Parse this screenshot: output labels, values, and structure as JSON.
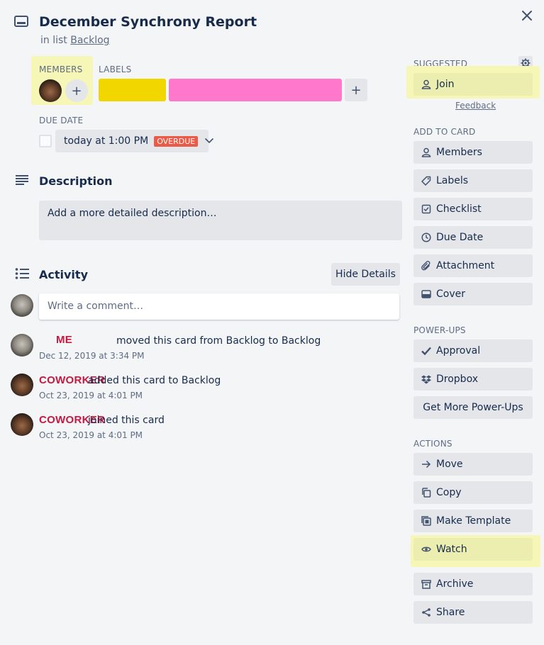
{
  "card": {
    "title": "December Synchrony Report",
    "in_list_prefix": "in list",
    "list_name": "Backlog"
  },
  "members": {
    "label": "MEMBERS",
    "add_label": "+"
  },
  "labels": {
    "label": "LABELS",
    "colors": [
      "#f2d600",
      "#ff78cb"
    ],
    "add_label": "+"
  },
  "due_date": {
    "label": "DUE DATE",
    "value": "today at 1:00 PM",
    "badge": "OVERDUE",
    "badge_color": "#eb5a46",
    "completed": false
  },
  "description": {
    "heading": "Description",
    "placeholder": "Add a more detailed description…"
  },
  "activity": {
    "heading": "Activity",
    "hide_details": "Hide Details",
    "comment_placeholder": "Write a comment…",
    "items": [
      {
        "avatar": "cat",
        "name": "ME",
        "text": "moved this card from Backlog to Backlog",
        "time": "Dec 12, 2019 at 3:34 PM"
      },
      {
        "avatar": "dark",
        "name": "COWORKER",
        "text": "added this card to Backlog",
        "time": "Oct 23, 2019 at 4:01 PM"
      },
      {
        "avatar": "dark",
        "name": "COWORKER",
        "text": "joined this card",
        "time": "Oct 23, 2019 at 4:01 PM"
      }
    ]
  },
  "sidebar": {
    "suggested": {
      "label": "SUGGESTED",
      "join": "Join",
      "feedback": "Feedback"
    },
    "add_to_card": {
      "label": "ADD TO CARD",
      "items": [
        {
          "icon": "person-icon",
          "label": "Members"
        },
        {
          "icon": "tag-icon",
          "label": "Labels"
        },
        {
          "icon": "checklist-icon",
          "label": "Checklist"
        },
        {
          "icon": "clock-icon",
          "label": "Due Date"
        },
        {
          "icon": "paperclip-icon",
          "label": "Attachment"
        },
        {
          "icon": "cover-icon",
          "label": "Cover"
        }
      ]
    },
    "power_ups": {
      "label": "POWER-UPS",
      "items": [
        {
          "icon": "checkmark-icon",
          "label": "Approval"
        },
        {
          "icon": "dropbox-icon",
          "label": "Dropbox"
        }
      ],
      "get_more": "Get More Power-Ups"
    },
    "actions": {
      "label": "ACTIONS",
      "items": [
        {
          "icon": "arrow-right-icon",
          "label": "Move"
        },
        {
          "icon": "copy-icon",
          "label": "Copy"
        },
        {
          "icon": "template-icon",
          "label": "Make Template"
        },
        {
          "icon": "eye-icon",
          "label": "Watch"
        },
        {
          "icon": "archive-icon",
          "label": "Archive"
        },
        {
          "icon": "share-icon",
          "label": "Share"
        }
      ]
    }
  },
  "highlight_color": "#f6f7b6"
}
